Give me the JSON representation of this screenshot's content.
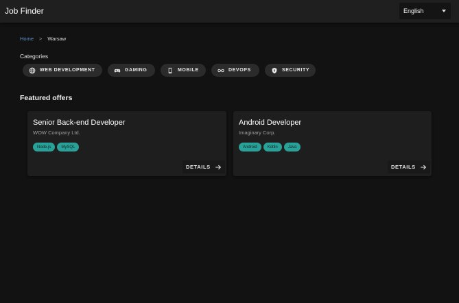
{
  "app": {
    "title": "Job Finder"
  },
  "language": {
    "selected": "English"
  },
  "breadcrumb": {
    "home": "Home",
    "separator": ">",
    "current": "Warsaw"
  },
  "categories": {
    "label": "Categories",
    "items": [
      {
        "label": "WEB DEVELOPMENT",
        "icon": "globe-icon"
      },
      {
        "label": "GAMING",
        "icon": "gamepad-icon"
      },
      {
        "label": "MOBILE",
        "icon": "phone-icon"
      },
      {
        "label": "DEVOPS",
        "icon": "infinity-icon"
      },
      {
        "label": "SECURITY",
        "icon": "shield-icon"
      }
    ]
  },
  "featured": {
    "title": "Featured offers",
    "offers": [
      {
        "title": "Senior Back-end Developer",
        "company": "WOW Company Ltd.",
        "tags": [
          "Node.js",
          "MySQL"
        ],
        "details_label": "DETAILS"
      },
      {
        "title": "Android Developer",
        "company": "Imaginary Corp.",
        "tags": [
          "Android",
          "Kotlin",
          "Java"
        ],
        "details_label": "DETAILS"
      }
    ]
  },
  "colors": {
    "background": "#121212",
    "appbar": "#1f1f1f",
    "card": "#1e1e1e",
    "chip": "#2b2b2b",
    "tag": "#2aa198",
    "link": "#5e92c8"
  }
}
